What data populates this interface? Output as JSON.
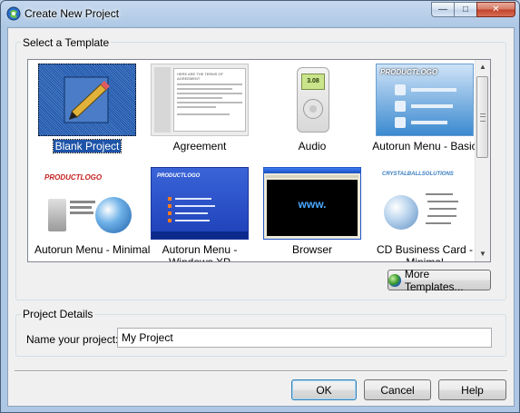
{
  "window": {
    "title": "Create New Project",
    "controls": {
      "minimize": "—",
      "maximize": "□",
      "close": "✕"
    }
  },
  "template_group": {
    "label": "Select a Template",
    "items": [
      {
        "label": "Blank Project",
        "selected": true
      },
      {
        "label": "Agreement",
        "thumb_text": "HERE ARE THE TERMS OF AGREEMENT"
      },
      {
        "label": "Audio",
        "thumb_text": "3.08"
      },
      {
        "label": "Autorun Menu - Basic",
        "thumb_text": "PRODUCTLOGO"
      },
      {
        "label": "Autorun Menu - Minimal",
        "thumb_text": "PRODUCTLOGO"
      },
      {
        "label": "Autorun Menu - Windows XP Theme",
        "thumb_text": "PRODUCTLOGO"
      },
      {
        "label": "Browser",
        "thumb_text": "www."
      },
      {
        "label": "CD Business Card - Minimal",
        "thumb_text": "CRYSTALBALLSOLUTIONS"
      }
    ],
    "more_button": "More Templates..."
  },
  "details_group": {
    "label": "Project Details",
    "name_label": "Name your project:",
    "name_value": "My Project"
  },
  "footer": {
    "ok": "OK",
    "cancel": "Cancel",
    "help": "Help"
  },
  "colors": {
    "selection": "#1d54a8",
    "title_bar": "#b9d1ea",
    "dialog_bg": "#f0f0f0",
    "close_button": "#c1412a"
  }
}
